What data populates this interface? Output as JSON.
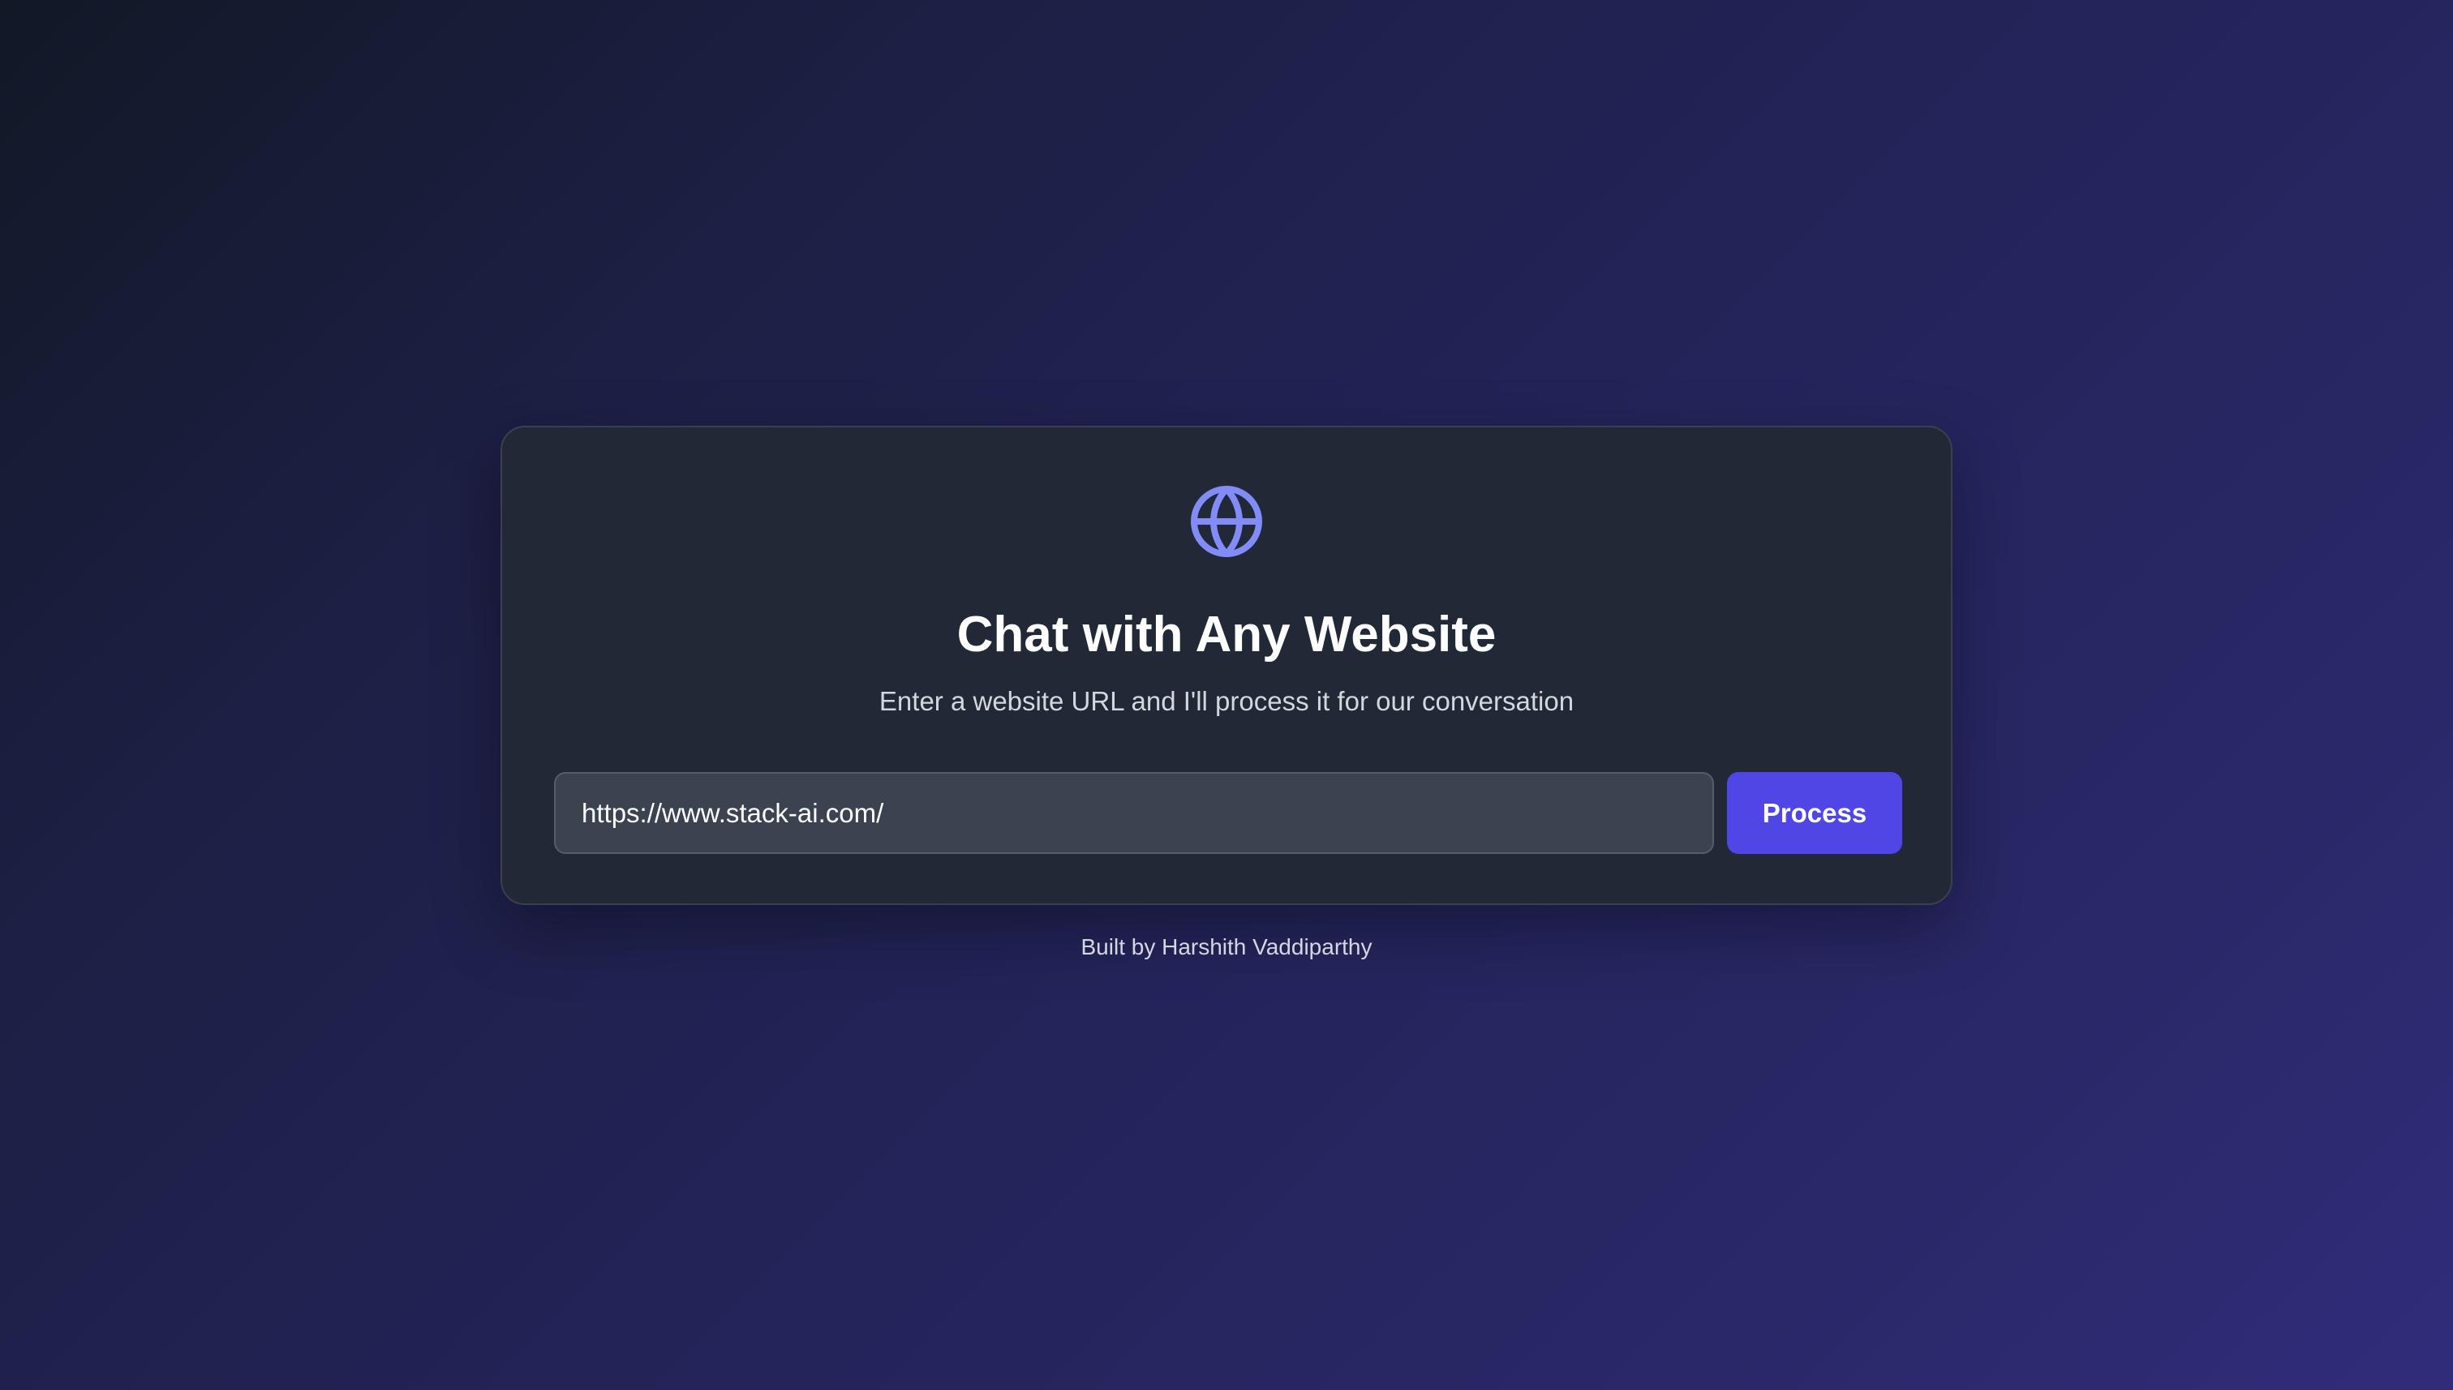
{
  "colors": {
    "accent": "#4f46e5",
    "icon": "#818cf8",
    "card_bg": "#212836",
    "input_bg": "#3b4250"
  },
  "card": {
    "icon": "globe-icon",
    "title": "Chat with Any Website",
    "subtitle": "Enter a website URL and I'll process it for our conversation",
    "url_input": {
      "value": "https://www.stack-ai.com/",
      "placeholder": ""
    },
    "process_label": "Process"
  },
  "footer": {
    "text": "Built by Harshith Vaddiparthy"
  }
}
